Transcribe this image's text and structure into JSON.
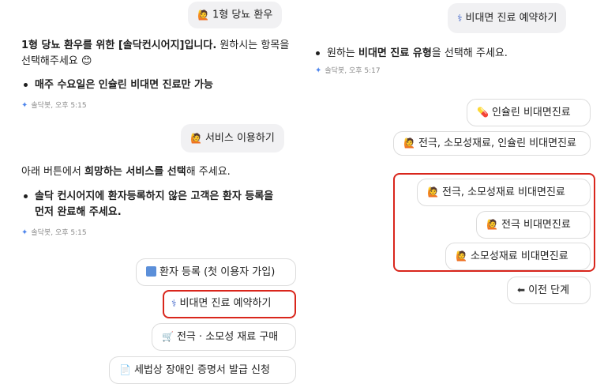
{
  "left": {
    "user_msg1": "1형 당뇨 환우",
    "bot_msg1_bold": "1형 당뇨 환우를 위한 [솔닥컨시어지]입니다.",
    "bot_msg1_rest": " 원하시는 항목을 선택해주세요 😊",
    "bullet1": "매주 수요일은 인슐린 비대면 진료만 가능",
    "meta1": "솔닥봇, 오후 5:15",
    "user_msg2": "서비스 이용하기",
    "bot_msg2_pre": "아래 버튼에서 ",
    "bot_msg2_bold": "희망하는 서비스를 선택",
    "bot_msg2_post": "해 주세요.",
    "bullet2": "솔닥 컨시어지에 환자등록하지 않은 고객은 환자 등록을 먼저 완료해 주세요.",
    "meta2": "솔닥봇, 오후 5:15",
    "buttons": [
      "환자 등록 (첫 이용자 가입)",
      "비대면 진료 예약하기",
      "전극 · 소모성 재료 구매",
      "세법상 장애인 증명서 발급 신청"
    ]
  },
  "right": {
    "user_msg": "비대면 진료 예약하기",
    "bullet_pre": "원하는 ",
    "bullet_bold": "비대면 진료 유형",
    "bullet_post": "을 선택해 주세요.",
    "meta": "솔닥봇, 오후 5:17",
    "buttons": [
      "인슐린 비대면진료",
      "전극, 소모성재료, 인슐린 비대면진료",
      "전극, 소모성재료 비대면진료",
      "전극 비대면진료",
      "소모성재료 비대면진료",
      "이전 단계"
    ]
  },
  "icons": {
    "person": "person-icon",
    "stethoscope": "stethoscope-icon",
    "monitor": "monitor-icon",
    "cart": "cart-icon",
    "document": "document-icon",
    "pill": "pill-icon",
    "back": "back-icon",
    "sparkle": "sparkle-icon"
  },
  "colors": {
    "highlight": "#d9261c",
    "bubble": "#f1f1f3",
    "accent": "#4f86ec"
  }
}
